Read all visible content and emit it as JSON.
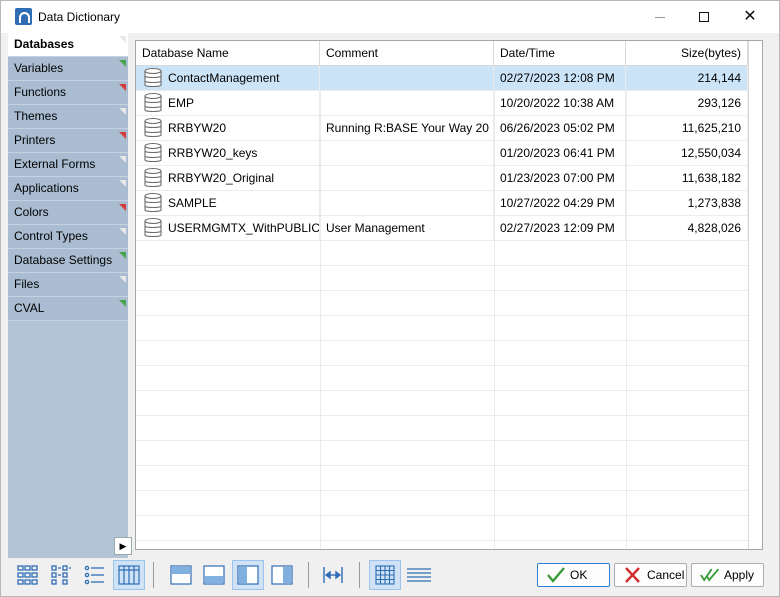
{
  "window": {
    "title": "Data Dictionary"
  },
  "sidebar": {
    "items": [
      {
        "label": "Databases",
        "active": true,
        "marker": "white"
      },
      {
        "label": "Variables",
        "marker": "green"
      },
      {
        "label": "Functions",
        "marker": "red"
      },
      {
        "label": "Themes",
        "marker": "white"
      },
      {
        "label": "Printers",
        "marker": "red"
      },
      {
        "label": "External Forms",
        "marker": "white"
      },
      {
        "label": "Applications",
        "marker": "white"
      },
      {
        "label": "Colors",
        "marker": "red"
      },
      {
        "label": "Control Types",
        "marker": "white"
      },
      {
        "label": "Database Settings",
        "marker": "green"
      },
      {
        "label": "Files",
        "marker": "white"
      },
      {
        "label": "CVAL",
        "marker": "green"
      }
    ],
    "expand_glyph": "▶"
  },
  "grid": {
    "columns": [
      "Database Name",
      "Comment",
      "Date/Time",
      "Size(bytes)"
    ],
    "rows": [
      {
        "name": "ContactManagement",
        "comment": "",
        "datetime": "02/27/2023 12:08 PM",
        "size": "214,144",
        "selected": true
      },
      {
        "name": "EMP",
        "comment": "",
        "datetime": "10/20/2022 10:38 AM",
        "size": "293,126"
      },
      {
        "name": "RRBYW20",
        "comment": "Running R:BASE Your Way 20",
        "datetime": "06/26/2023 05:02 PM",
        "size": "11,625,210"
      },
      {
        "name": "RRBYW20_keys",
        "comment": "",
        "datetime": "01/20/2023 06:41 PM",
        "size": "12,550,034"
      },
      {
        "name": "RRBYW20_Original",
        "comment": "",
        "datetime": "01/23/2023 07:00 PM",
        "size": "11,638,182"
      },
      {
        "name": "SAMPLE",
        "comment": "",
        "datetime": "10/27/2022 04:29 PM",
        "size": "1,273,838"
      },
      {
        "name": "USERMGMTX_WithPUBLIC",
        "comment": "User Management",
        "datetime": "02/27/2023 12:09 PM",
        "size": "4,828,026"
      }
    ]
  },
  "buttons": {
    "ok": "OK",
    "cancel": "Cancel",
    "apply": "Apply"
  },
  "colors": {
    "selection": "#cce4f7",
    "sidebar": "#a9bcd1",
    "accent": "#2d7fd4"
  }
}
